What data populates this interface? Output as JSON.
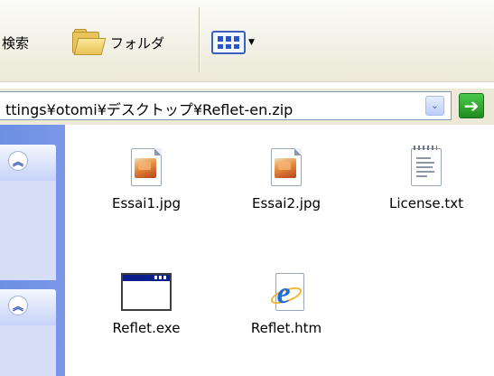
{
  "toolbar": {
    "search_label": "検索",
    "folders_label": "フォルダ",
    "views_icon": "views-icon"
  },
  "address": {
    "path": "ttings¥otomi¥デスクトップ¥Reflet-en.zip",
    "dropdown_glyph": "⌄",
    "go_glyph": "➔"
  },
  "taskpane": {
    "collapse_glyph": "︽"
  },
  "files": [
    {
      "name": "Essai1.jpg",
      "icon": "jpeg-image-icon"
    },
    {
      "name": "Essai2.jpg",
      "icon": "jpeg-image-icon"
    },
    {
      "name": "License.txt",
      "icon": "text-file-icon"
    },
    {
      "name": "Reflet.exe",
      "icon": "application-icon"
    },
    {
      "name": "Reflet.htm",
      "icon": "internet-explorer-html-icon"
    }
  ]
}
